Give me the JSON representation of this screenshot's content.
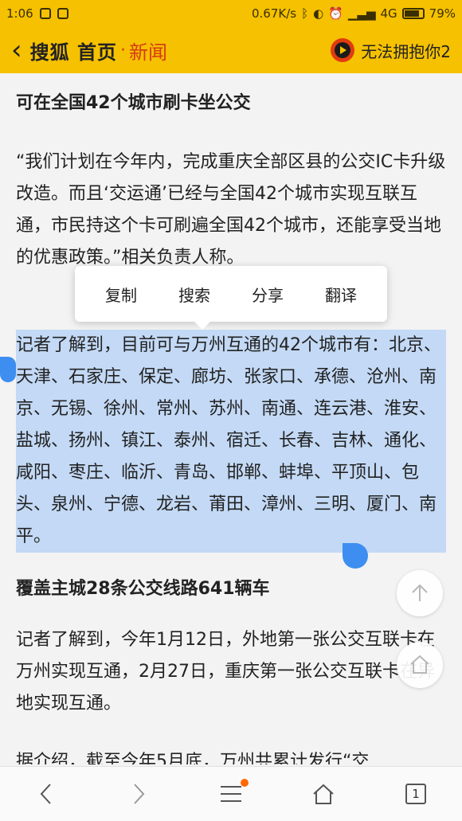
{
  "status_bar": {
    "time": "1:06",
    "speed": "0.67K/s",
    "network": "4G",
    "battery": "79%"
  },
  "header": {
    "brand": "搜狐 首页",
    "section": "新闻",
    "song": "无法拥抱你2"
  },
  "article": {
    "heading1": "可在全国42个城市刷卡坐公交",
    "para1": "“我们计划在今年内，完成重庆全部区县的公交IC卡升级改造。而且‘交运通’已经与全国42个城市实现互联互通，市民持这个卡可刷遍全国42个城市，还能享受当地的优惠政策。”相关负责人称。",
    "para2": "记者了解到，目前可与万州互通的42个城市有：北京、天津、石家庄、保定、廊坊、张家口、承德、沧州、南京、无锡、徐州、常州、苏州、南通、连云港、淮安、盐城、扬州、镇江、泰州、宿迁、长春、吉林、通化、咸阳、枣庄、临沂、青岛、邯郸、蚌埠、平顶山、包头、泉州、宁德、龙岩、莆田、漳州、三明、厦门、南平。",
    "heading2": "覆盖主城28条公交线路641辆车",
    "para3": "记者了解到，今年1月12日，外地第一张公交互联卡在万州实现互通，2月27日，重庆第一张公交互联卡在异地实现互通。",
    "para4": "据介绍，截至今年5月底，万州共累计发行“交"
  },
  "context_menu": {
    "copy": "复制",
    "search": "搜索",
    "share": "分享",
    "translate": "翻译"
  },
  "bottom_nav": {
    "tab_count": "1"
  },
  "colors": {
    "accent": "#f5c100",
    "selection": "#c3d9f5",
    "handle": "#3d8ef0",
    "section_red": "#d63a13"
  }
}
